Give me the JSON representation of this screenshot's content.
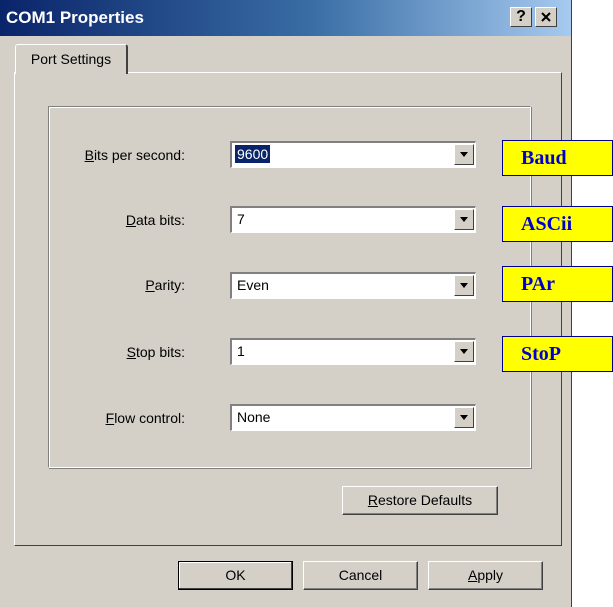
{
  "window": {
    "title": "COM1 Properties",
    "help_label": "?",
    "close_label": "✕"
  },
  "tab": {
    "label": "Port Settings"
  },
  "fields": {
    "bits_per_second": {
      "label_u": "B",
      "label_rest": "its per second:",
      "value": "9600"
    },
    "data_bits": {
      "label_u": "D",
      "label_rest": "ata bits:",
      "value": "7"
    },
    "parity": {
      "label_pre": "",
      "label_u": "P",
      "label_rest": "arity:",
      "value": "Even"
    },
    "stop_bits": {
      "label_u": "S",
      "label_rest": "top bits:",
      "value": "1"
    },
    "flow_control": {
      "label_u": "F",
      "label_rest": "low control:",
      "value": "None"
    }
  },
  "callouts": {
    "baud": "Baud",
    "ascii": "ASCii",
    "parity": "PAr",
    "stop": "StoP"
  },
  "buttons": {
    "restore_u": "R",
    "restore_rest": "estore Defaults",
    "ok": "OK",
    "cancel": "Cancel",
    "apply_u": "A",
    "apply_rest": "pply"
  }
}
